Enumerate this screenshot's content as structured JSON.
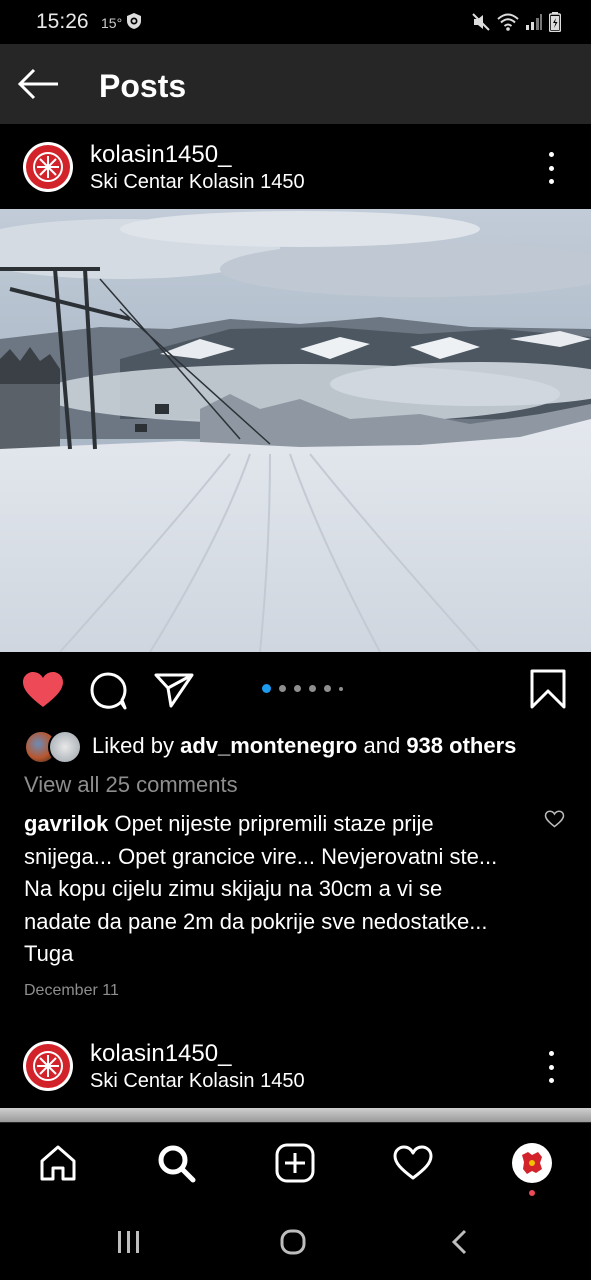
{
  "status_bar": {
    "time": "15:26",
    "temperature": "15°",
    "icons": [
      "shield-icon",
      "mute-icon",
      "wifi-icon",
      "signal-icon",
      "battery-icon"
    ]
  },
  "header": {
    "back_icon": "arrow-left-icon",
    "title": "Posts"
  },
  "post": {
    "username": "kolasin1450_",
    "location": "Ski Centar Kolasin 1450",
    "image": "snowy ski slope with chairlift and misty mountains",
    "carousel": {
      "count": 6,
      "active_index": 0
    },
    "actions": [
      "heart-icon",
      "comment-icon",
      "share-icon",
      "bookmark-icon"
    ],
    "liked": true,
    "likes": {
      "prefix": "Liked by",
      "user": "adv_montenegro",
      "conjunction": "and",
      "others": "938 others"
    },
    "view_comments": "View all 25 comments",
    "comment": {
      "author": "gavrilok",
      "text": "Opet nijeste pripremili staze prije snijega... Opet grancice vire... Nevjerovatni ste... Na kopu cijelu zimu skijaju na 30cm a vi se nadate da pane 2m da pokrije sve nedostatke... Tuga"
    },
    "date": "December 11"
  },
  "next_post": {
    "username": "kolasin1450_",
    "location": "Ski Centar Kolasin 1450"
  },
  "bottom_nav": [
    "home-icon",
    "search-icon",
    "create-icon",
    "activity-icon",
    "profile-icon"
  ],
  "system_nav": [
    "recents-icon",
    "home-circle-icon",
    "back-chevron-icon"
  ],
  "colors": {
    "like_red": "#ed4956",
    "carousel_active": "#1d9bf0",
    "header_bg": "#262626",
    "brand_red": "#d2232a"
  }
}
